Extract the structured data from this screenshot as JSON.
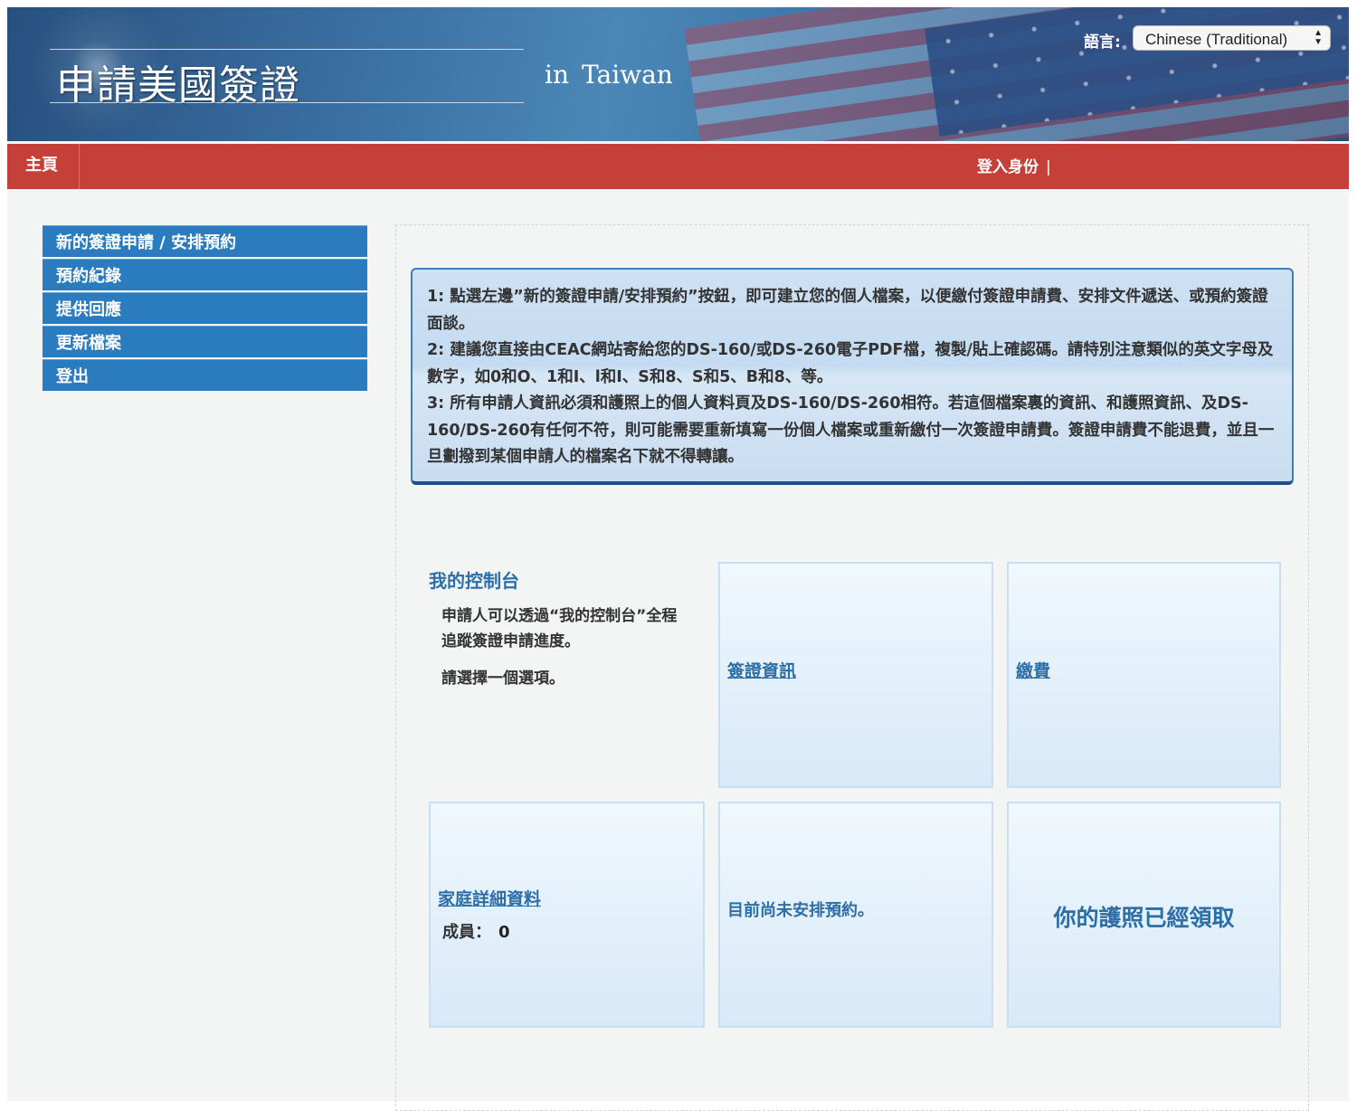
{
  "header": {
    "title": "申請美國簽證",
    "sub_in": "in",
    "sub_country": "Taiwan",
    "language_label": "語言:",
    "language_selected": "Chinese (Traditional)"
  },
  "navbar": {
    "home": "主頁",
    "login_identity": "登入身份",
    "separator": "|"
  },
  "sidebar": {
    "items": [
      {
        "label": "新的簽證申請 / 安排預約"
      },
      {
        "label": "預約紀錄"
      },
      {
        "label": "提供回應"
      },
      {
        "label": "更新檔案"
      },
      {
        "label": "登出"
      }
    ]
  },
  "notice": {
    "items": [
      "1: 點選左邊”新的簽證申請/安排預約”按鈕，即可建立您的個人檔案，以便繳付簽證申請費、安排文件遞送、或預約簽證面談。",
      "2: 建議您直接由CEAC網站寄給您的DS-160/或DS-260電子PDF檔，複製/貼上確認碼。請特別注意類似的英文字母及數字，如0和O、1和I、l和I、S和8、S和5、B和8、等。",
      "3: 所有申請人資訊必須和護照上的個人資料頁及DS-160/DS-260相符。若這個檔案裏的資訊、和護照資訊、及DS-160/DS-260有任何不符，則可能需要重新填寫一份個人檔案或重新繳付一次簽證申請費。簽證申請費不能退費，並且一旦劃撥到某個申請人的檔案名下就不得轉讓。"
    ]
  },
  "dashboard": {
    "title": "我的控制台",
    "description": "申請人可以透過“我的控制台”全程追蹤簽證申請進度。",
    "choose": "請選擇一個選項。",
    "visa_info_link": "簽證資訊",
    "payment_link": "繳費",
    "family_link": "家庭詳細資料",
    "members_label": "成員：",
    "members_count": "0",
    "appointment_status": "目前尚未安排預約。",
    "passport_status": "你的護照已經領取"
  },
  "colors": {
    "nav_red": "#c6403a",
    "sidebar_blue": "#2b7bbf",
    "link_blue": "#2c6ea8"
  }
}
